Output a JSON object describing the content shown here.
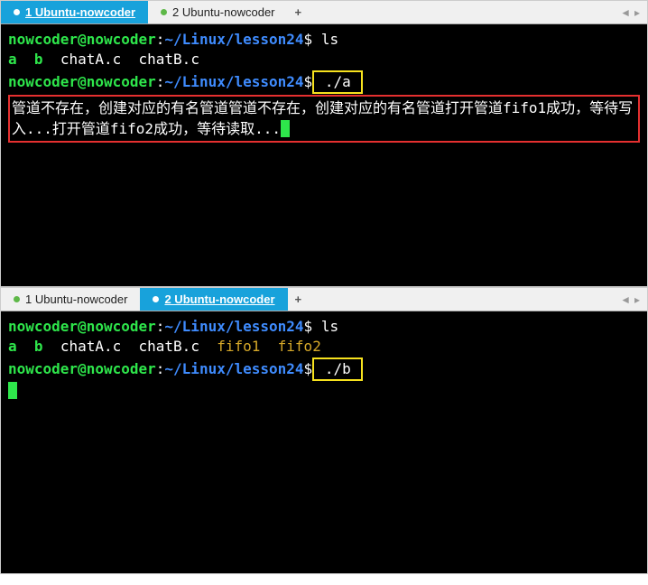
{
  "terminals": [
    {
      "tabs": [
        {
          "id": "tab1a",
          "label": "1 Ubuntu-nowcoder",
          "active": true
        },
        {
          "id": "tab1b",
          "label": "2 Ubuntu-nowcoder",
          "active": false
        }
      ],
      "prompt_user": "nowcoder@nowcoder",
      "prompt_path": "~/Linux/lesson24",
      "cmd1": "ls",
      "ls_output": {
        "exe1": "a",
        "exe2": "b",
        "file1": "chatA.c",
        "file2": "chatB.c"
      },
      "cmd2": "./a",
      "program_output": "管道不存在，创建对应的有名管道管道不存在，创建对应的有名管道打开管道fifo1成功，等待写入...打开管道fifo2成功，等待读取..."
    },
    {
      "tabs": [
        {
          "id": "tab2a",
          "label": "1 Ubuntu-nowcoder",
          "active": false
        },
        {
          "id": "tab2b",
          "label": "2 Ubuntu-nowcoder",
          "active": true
        }
      ],
      "prompt_user": "nowcoder@nowcoder",
      "prompt_path": "~/Linux/lesson24",
      "cmd1": "ls",
      "ls_output": {
        "exe1": "a",
        "exe2": "b",
        "file1": "chatA.c",
        "file2": "chatB.c",
        "pipe1": "fifo1",
        "pipe2": "fifo2"
      },
      "cmd2": "./b"
    }
  ],
  "dollar": "$",
  "colon": ":",
  "plus": "+",
  "nav_left": "◄",
  "nav_right": "▸"
}
